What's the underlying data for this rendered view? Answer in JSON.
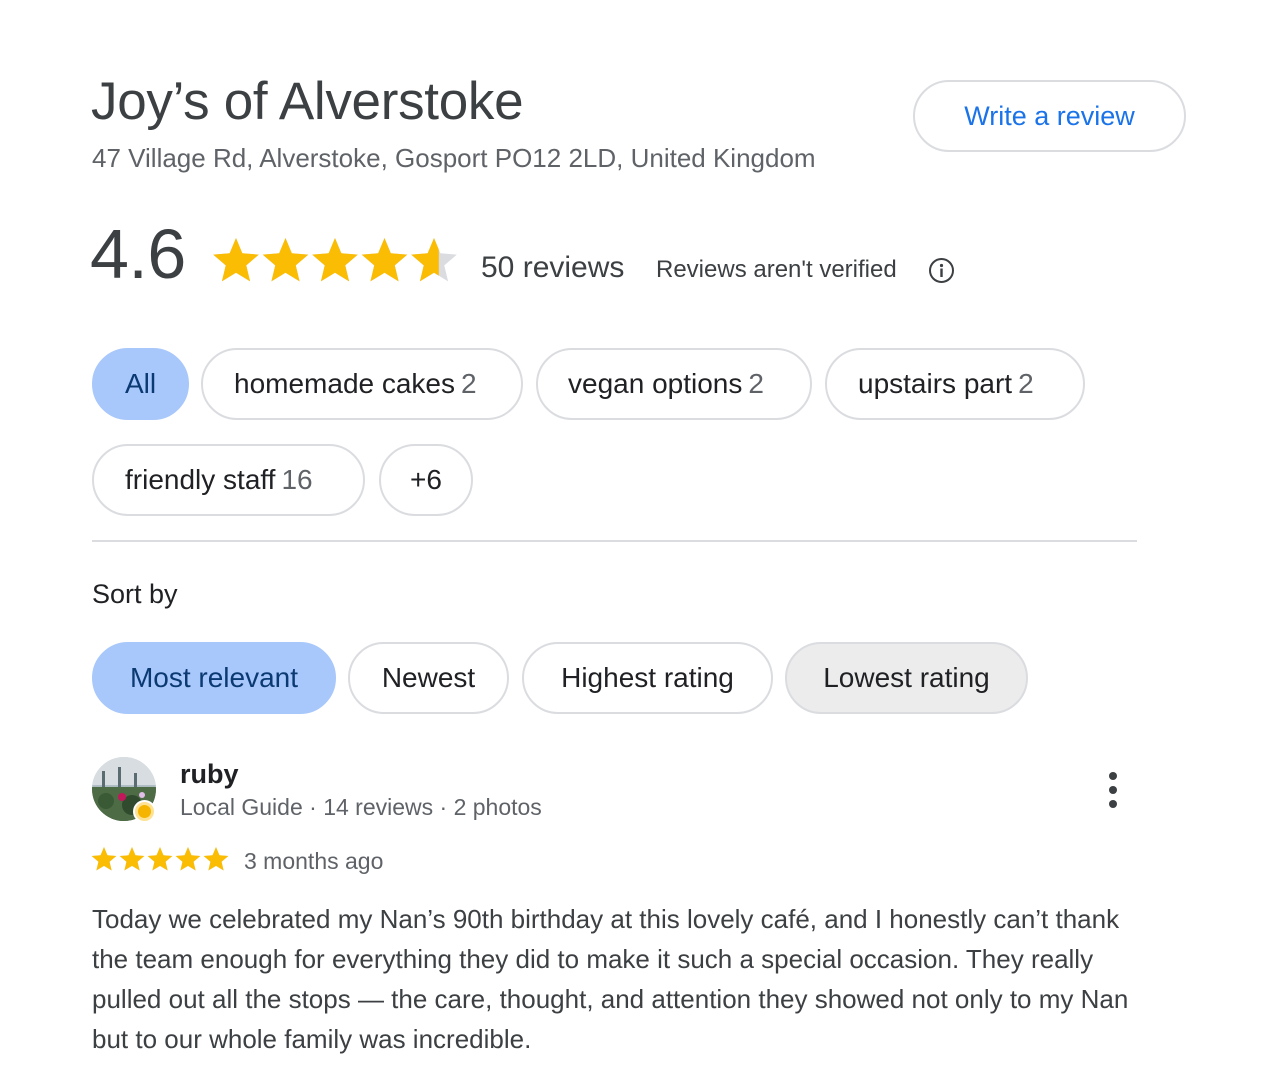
{
  "place": {
    "name": "Joy’s of Alverstoke",
    "address": "47 Village Rd, Alverstoke, Gosport PO12 2LD, United Kingdom",
    "write_review_label": "Write a review"
  },
  "rating": {
    "value": "4.6",
    "stars_filled": 4.6,
    "stars_max": 5,
    "review_count": "50 reviews",
    "verification_note": "Reviews aren't verified",
    "star_color": "#fbbc04",
    "star_empty_color": "#dadce0"
  },
  "topics": [
    {
      "label": "All",
      "count": "",
      "selected": true
    },
    {
      "label": "homemade cakes",
      "count": "2",
      "selected": false
    },
    {
      "label": "vegan options",
      "count": "2",
      "selected": false
    },
    {
      "label": "upstairs part",
      "count": "2",
      "selected": false
    },
    {
      "label": "friendly staff",
      "count": "16",
      "selected": false
    },
    {
      "label": "+6",
      "count": "",
      "selected": false
    }
  ],
  "sort": {
    "label": "Sort by",
    "options": [
      {
        "label": "Most relevant",
        "selected": true
      },
      {
        "label": "Newest",
        "selected": false
      },
      {
        "label": "Highest rating",
        "selected": false
      },
      {
        "label": "Lowest rating",
        "selected": false,
        "hovered": true
      }
    ]
  },
  "review": {
    "author": "ruby",
    "author_meta": "Local Guide · 14 reviews · 2 photos",
    "stars": 5,
    "time": "3 months ago",
    "text": "Today we celebrated my Nan’s 90th birthday at this lovely café, and I honestly can’t thank the team enough for everything they did to make it such a special occasion. They really pulled out all the stops — the care, thought, and attention they showed not only to my Nan but to our whole family was incredible."
  },
  "colors": {
    "accent_blue": "#1a73e8",
    "selected_chip": "#a8c7fa",
    "chip_border": "#dadce0"
  },
  "icons": {
    "info": "info-circle-icon",
    "more": "more-vert-icon",
    "star": "star-icon",
    "local_guide_badge": "local-guide-badge-icon"
  }
}
